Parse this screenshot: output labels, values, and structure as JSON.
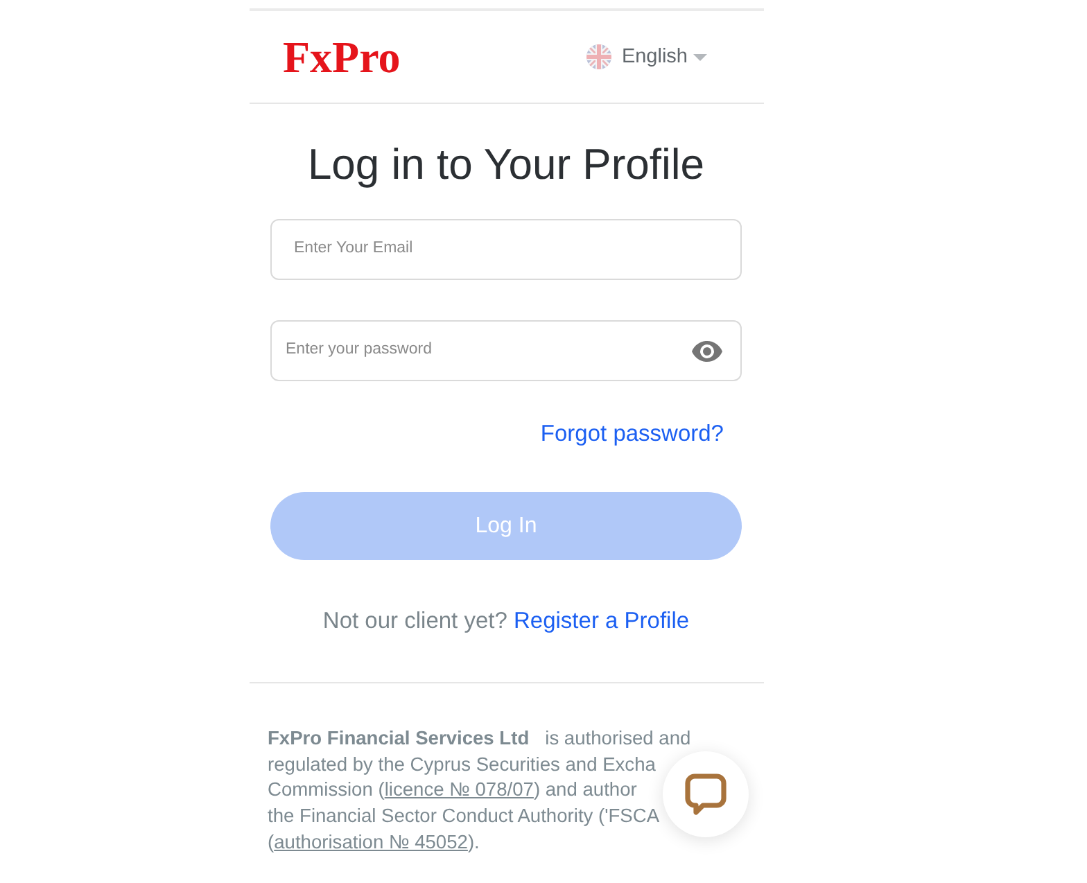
{
  "header": {
    "logo": "FxPro",
    "language": {
      "label": "English"
    }
  },
  "title": "Log in to Your Profile",
  "email_field": {
    "placeholder": "Enter Your Email"
  },
  "password_field": {
    "placeholder": "Enter your password"
  },
  "forgot_link": "Forgot password?",
  "login_button": {
    "label": "Log In",
    "disabled": true
  },
  "register": {
    "prompt": "Not our client yet?",
    "link": "Register a Profile"
  },
  "disclaimer": {
    "lines": [
      [
        {
          "kind": "text",
          "text": "**FxPro Financial Services Ltd**   is authorised and"
        }
      ],
      [
        {
          "kind": "text",
          "text": "regulated by the Cyprus Securities and Excha"
        }
      ],
      [
        {
          "kind": "text",
          "text": "Commission ("
        },
        {
          "kind": "link",
          "text": "licence № 078/07"
        },
        {
          "kind": "text",
          "text": ") and author"
        }
      ],
      [
        {
          "kind": "text",
          "text": "the Financial Sector Conduct Authority ('FSCA"
        }
      ],
      [
        {
          "kind": "text",
          "text": "("
        },
        {
          "kind": "link",
          "text": "authorisation № 45052"
        },
        {
          "kind": "text",
          "text": ")."
        }
      ]
    ]
  }
}
